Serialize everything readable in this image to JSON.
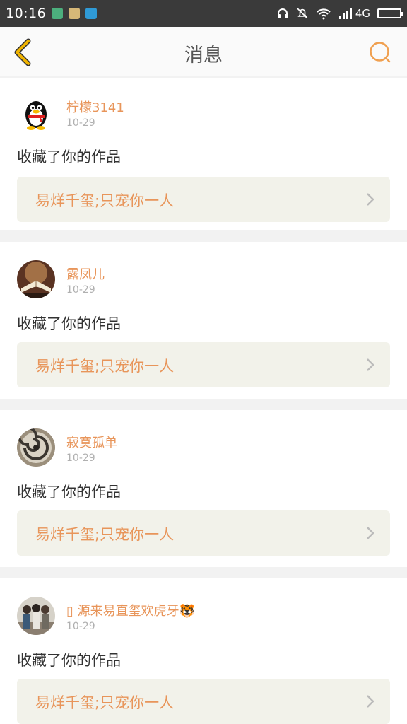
{
  "status_bar": {
    "time": "10:16",
    "network": "4G"
  },
  "header": {
    "title": "消息"
  },
  "messages": [
    {
      "username": "柠檬3141",
      "date": "10-29",
      "action": "收藏了你的作品",
      "work_title": "易烊千玺;只宠你一人"
    },
    {
      "username": "露凤儿",
      "date": "10-29",
      "action": "收藏了你的作品",
      "work_title": "易烊千玺;只宠你一人"
    },
    {
      "username": "寂寞孤单",
      "date": "10-29",
      "action": "收藏了你的作品",
      "work_title": "易烊千玺;只宠你一人"
    },
    {
      "username": "▯ 源来易直玺欢虎牙🐯",
      "date": "10-29",
      "action": "收藏了你的作品",
      "work_title": "易烊千玺;只宠你一人"
    }
  ],
  "colors": {
    "accent": "#e8955a",
    "status_bar": "#3a3a3a",
    "work_bg": "#f2f2ea",
    "back_icon": "#f0b400"
  },
  "icons": [
    "back-chevron-icon",
    "search-icon",
    "chevron-right-icon",
    "headphones-icon",
    "mute-bell-icon",
    "wifi-icon",
    "signal-icon",
    "battery-icon"
  ]
}
